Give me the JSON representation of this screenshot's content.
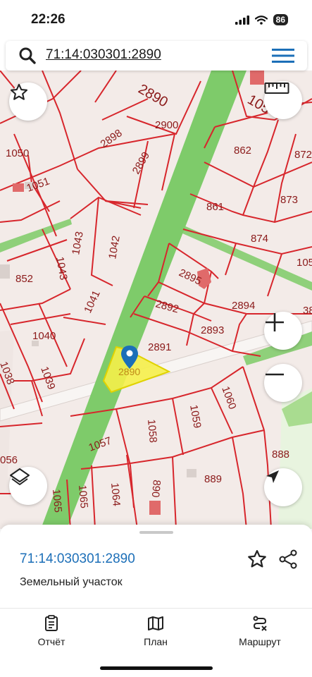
{
  "status_bar": {
    "time": "22:26",
    "battery": "86"
  },
  "search": {
    "query": "71:14:030301:2890"
  },
  "map": {
    "plot_labels": [
      {
        "text": "2900"
      },
      {
        "text": "2898"
      },
      {
        "text": "2899"
      },
      {
        "text": "2890"
      },
      {
        "text": "1050"
      },
      {
        "text": "1051"
      },
      {
        "text": "862"
      },
      {
        "text": "872"
      },
      {
        "text": "861"
      },
      {
        "text": "873"
      },
      {
        "text": "874"
      },
      {
        "text": "105"
      },
      {
        "text": "1043"
      },
      {
        "text": "1043"
      },
      {
        "text": "1042"
      },
      {
        "text": "852"
      },
      {
        "text": "2895"
      },
      {
        "text": "2894"
      },
      {
        "text": "2892"
      },
      {
        "text": "2893"
      },
      {
        "text": "1041"
      },
      {
        "text": "2891"
      },
      {
        "text": "1040"
      },
      {
        "text": "1038"
      },
      {
        "text": "1039"
      },
      {
        "text": "2890"
      },
      {
        "text": "1060"
      },
      {
        "text": "1059"
      },
      {
        "text": "1058"
      },
      {
        "text": "1057"
      },
      {
        "text": "056"
      },
      {
        "text": "888"
      },
      {
        "text": "889"
      },
      {
        "text": "890"
      },
      {
        "text": "1064"
      },
      {
        "text": "1065"
      },
      {
        "text": "1065"
      },
      {
        "text": "38"
      },
      {
        "text": "105"
      }
    ],
    "selected_parcel_color": "#f5f04a",
    "road_color": "#7ecb6a",
    "boundary_color": "#d7262c"
  },
  "controls": {
    "favorite_icon": "star-outline",
    "ruler_icon": "ruler",
    "zoom_in_icon": "plus",
    "zoom_out_icon": "minus",
    "layers_icon": "layers",
    "location_icon": "navigation-arrow"
  },
  "sheet": {
    "cadastral_number": "71:14:030301:2890",
    "parcel_type": "Земельный участок"
  },
  "tabs": [
    {
      "label": "Отчёт",
      "icon": "report-icon"
    },
    {
      "label": "План",
      "icon": "map-icon"
    },
    {
      "label": "Маршрут",
      "icon": "route-icon"
    }
  ],
  "colors": {
    "accent": "#1c6fb8",
    "menu": "#1c6fb8"
  }
}
